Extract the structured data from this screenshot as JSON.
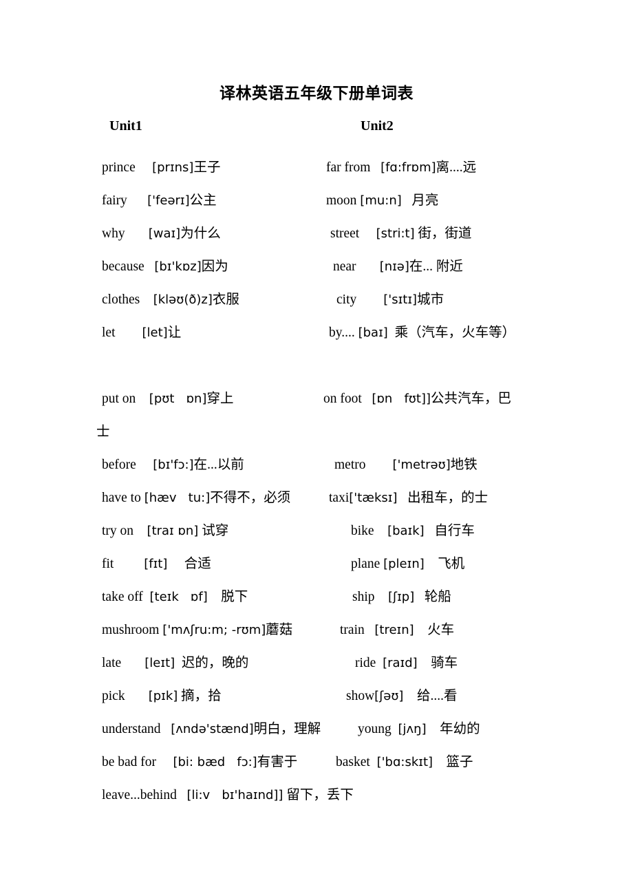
{
  "document": {
    "title": "译林英语五年级下册单词表",
    "unit_headings": [
      {
        "label": "Unit1"
      },
      {
        "label": "Unit2"
      }
    ]
  },
  "rows": [
    {
      "left": {
        "word": "prince",
        "ipa": "[prɪns]",
        "cn": "王子"
      },
      "right": {
        "word": "far from",
        "ipa": "[fɑ:frɒm]",
        "cn": "离....远"
      }
    },
    {
      "left": {
        "word": "fairy",
        "ipa": "['feərɪ]",
        "cn": "公主"
      },
      "right": {
        "word": "moon",
        "ipa": "[mu:n]",
        "cn": "月亮"
      }
    },
    {
      "left": {
        "word": "why",
        "ipa": "[waɪ]",
        "cn": "为什么"
      },
      "right": {
        "word": "street",
        "ipa": "[stri:t]",
        "cn": "街，街道"
      }
    },
    {
      "left": {
        "word": "because",
        "ipa": "[bɪ'kɒz]",
        "cn": "因为"
      },
      "right": {
        "word": "near",
        "ipa": "[nɪə]",
        "cn": "在... 附近"
      }
    },
    {
      "left": {
        "word": "clothes",
        "ipa": "[kləʊ(ð)z]",
        "cn": "衣服"
      },
      "right": {
        "word": "city",
        "ipa": "['sɪtɪ]",
        "cn": "城市"
      }
    },
    {
      "left": {
        "word": "let",
        "ipa": "[let]",
        "cn": "让"
      },
      "right": {
        "word": "by....",
        "ipa": "[baɪ]",
        "cn": "乘（汽车，火车等）"
      }
    },
    {
      "left": {
        "word": "put on",
        "ipa": "[pʊt   ɒn]",
        "cn": "穿上"
      },
      "right": {
        "word": "on foot",
        "ipa": "[ɒn   fʊt]]",
        "cn": "公共汽车，巴"
      }
    },
    {
      "left": {
        "word": "before",
        "ipa": "[bɪ'fɔ:]",
        "cn": "在...以前"
      },
      "right": {
        "word": "metro",
        "ipa": "['metrəʊ]",
        "cn": "地铁"
      }
    },
    {
      "left": {
        "word": "have to",
        "ipa": "[hæv   tu:]",
        "cn": "不得不，必须"
      },
      "right": {
        "word": "taxi",
        "ipa": "['tæksɪ]",
        "cn": "出租车，的士"
      }
    },
    {
      "left": {
        "word": "try on",
        "ipa": "[traɪ ɒn]",
        "cn": "试穿"
      },
      "right": {
        "word": "bike",
        "ipa": "[baɪk]",
        "cn": "自行车"
      }
    },
    {
      "left": {
        "word": "fit",
        "ipa": "[fɪt]",
        "cn": "合适"
      },
      "right": {
        "word": "plane",
        "ipa": "[pleɪn]",
        "cn": "飞机"
      }
    },
    {
      "left": {
        "word": "take off",
        "ipa": "[teɪk   ɒf]",
        "cn": "脱下"
      },
      "right": {
        "word": "ship",
        "ipa": "[ʃɪp]",
        "cn": "轮船"
      }
    },
    {
      "left": {
        "word": "mushroom",
        "ipa": "['mʌʃru:m; -rʊm]",
        "cn": "蘑菇"
      },
      "right": {
        "word": "train",
        "ipa": "[treɪn]",
        "cn": "火车"
      }
    },
    {
      "left": {
        "word": "late",
        "ipa": "[leɪt]",
        "cn": "迟的，晚的"
      },
      "right": {
        "word": "ride",
        "ipa": "[raɪd]",
        "cn": "骑车"
      }
    },
    {
      "left": {
        "word": "pick",
        "ipa": "[pɪk]",
        "cn": "摘，拾"
      },
      "right": {
        "word": "show",
        "ipa": "[ʃəʊ]",
        "cn": "给....看"
      }
    },
    {
      "left": {
        "word": "understand",
        "ipa": "[ʌndə'stænd]",
        "cn": "明白，理解"
      },
      "right": {
        "word": "young",
        "ipa": "[jʌŋ]",
        "cn": "年幼的"
      }
    },
    {
      "left": {
        "word": "be bad for",
        "ipa": "[bi: bæd   fɔ:]",
        "cn": "有害于"
      },
      "right": {
        "word": "basket",
        "ipa": "['bɑ:skɪt]",
        "cn": "篮子"
      }
    },
    {
      "left": {
        "word": "leave...behind",
        "ipa": "[li:v   bɪ'haɪnd]]",
        "cn": "留下，丢下"
      },
      "right": {
        "word": "",
        "ipa": "",
        "cn": ""
      }
    }
  ],
  "wrapped_text": {
    "continuation": "士"
  }
}
